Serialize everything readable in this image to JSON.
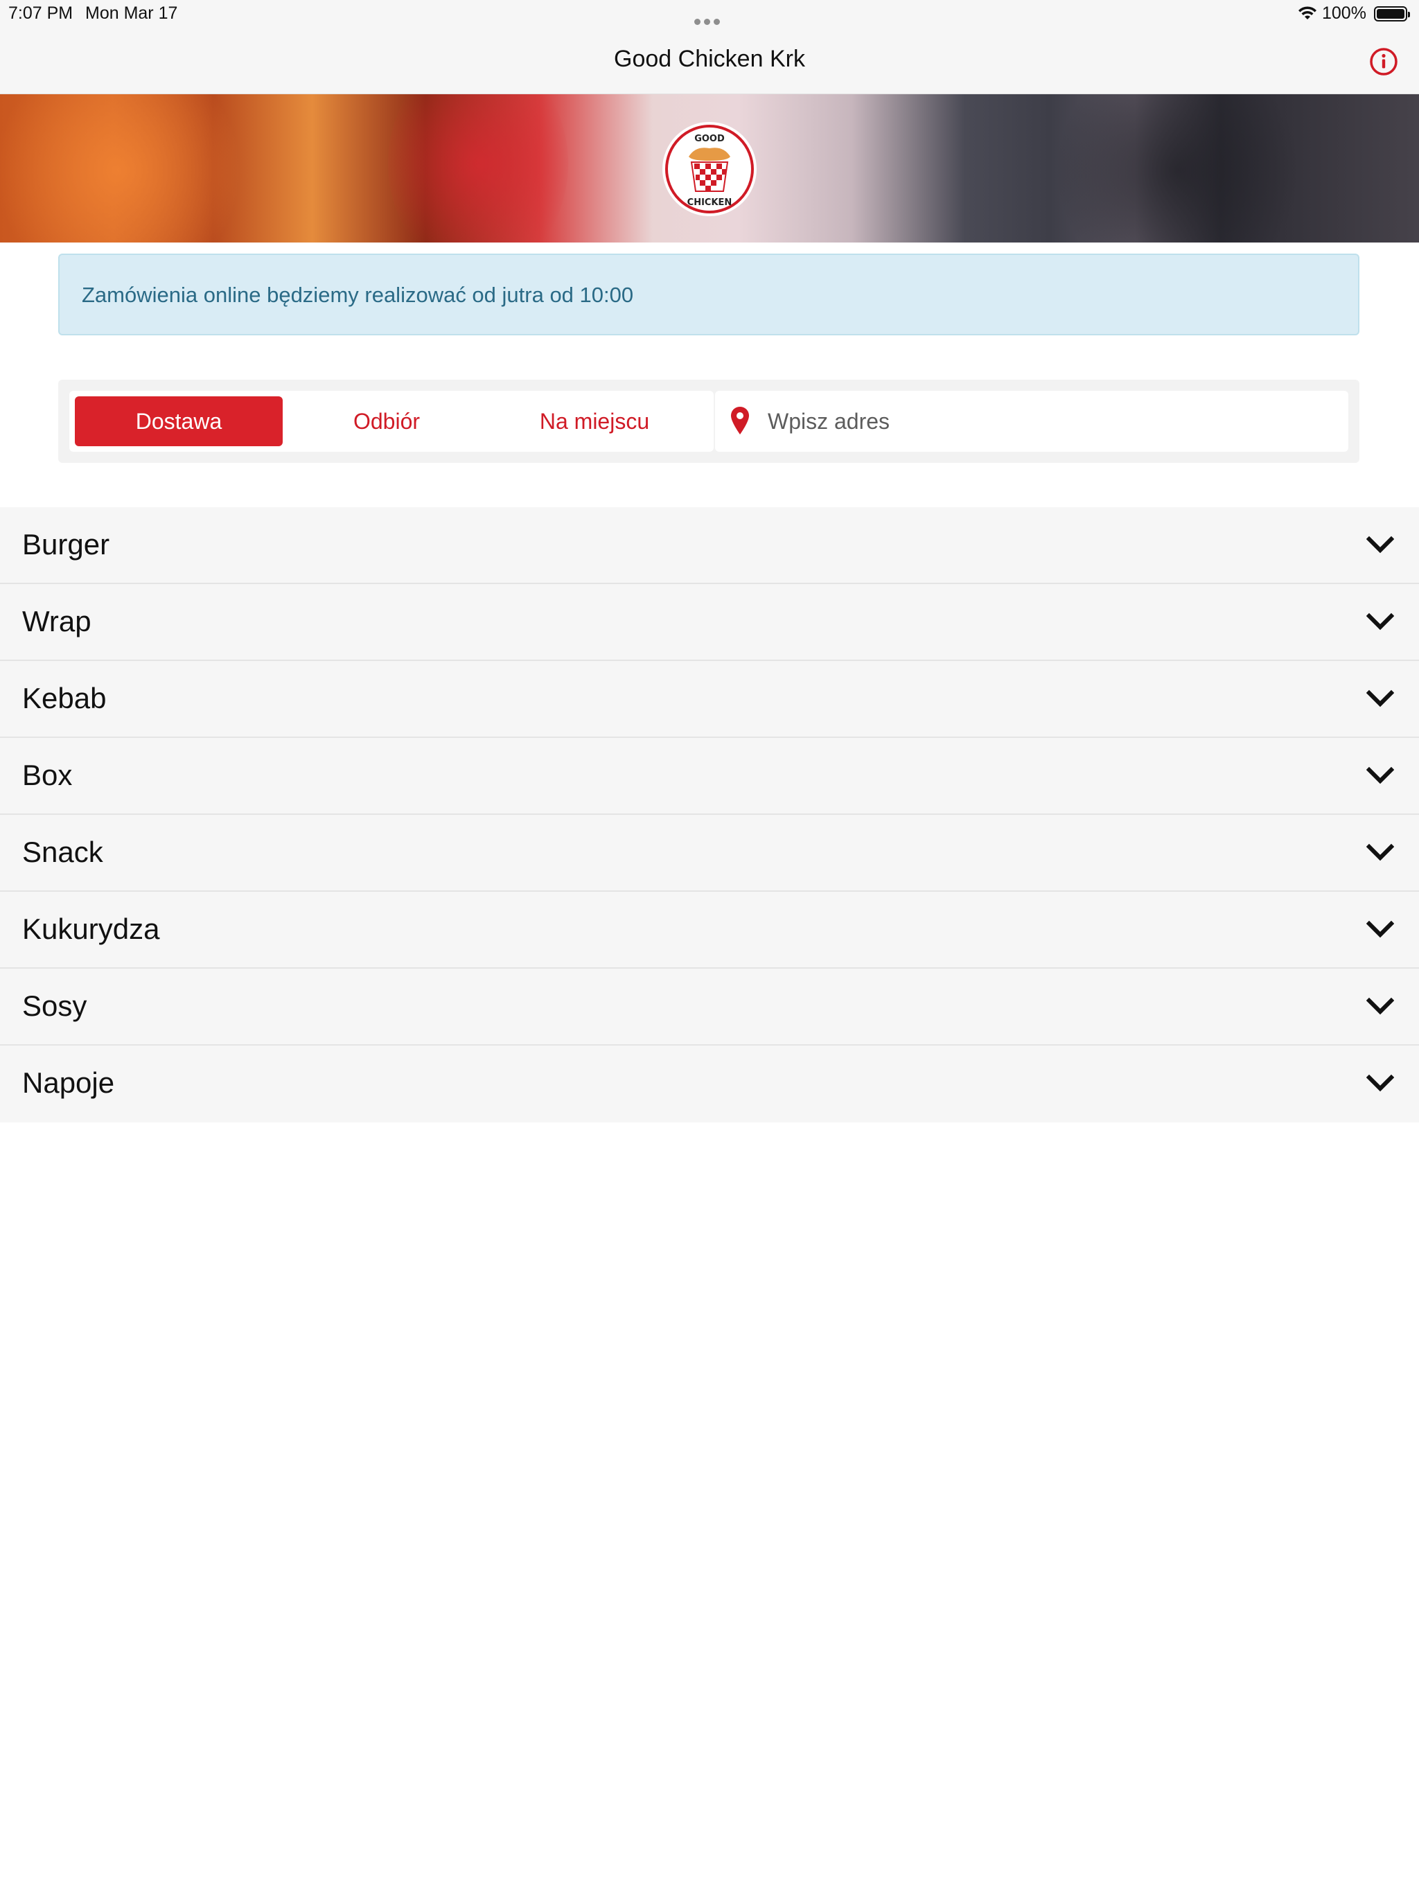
{
  "status_bar": {
    "time": "7:07 PM",
    "date": "Mon Mar 17",
    "battery_percent": "100%",
    "battery_level": 1.0,
    "wifi_icon": "wifi-icon",
    "battery_icon": "battery-icon"
  },
  "nav": {
    "title": "Good Chicken Krk",
    "info_icon": "info-icon"
  },
  "hero": {
    "logo_icon": "good-chicken-logo",
    "logo_text_top": "GOOD",
    "logo_text_bottom": "CHICKEN"
  },
  "banner": {
    "text": "Zamówienia online będziemy realizować od jutra od 10:00"
  },
  "order": {
    "modes": [
      {
        "label": "Dostawa",
        "active": true
      },
      {
        "label": "Odbiór",
        "active": false
      },
      {
        "label": "Na miejscu",
        "active": false
      }
    ],
    "address_placeholder": "Wpisz adres",
    "address_icon": "map-pin-icon"
  },
  "categories": [
    {
      "label": "Burger"
    },
    {
      "label": "Wrap"
    },
    {
      "label": "Kebab"
    },
    {
      "label": "Box"
    },
    {
      "label": "Snack"
    },
    {
      "label": "Kukurydza"
    },
    {
      "label": "Sosy"
    },
    {
      "label": "Napoje"
    }
  ],
  "colors": {
    "brand_red": "#d9222a",
    "banner_bg": "#d9ecf5",
    "banner_text": "#2a6a86",
    "row_bg": "#f6f6f6"
  }
}
